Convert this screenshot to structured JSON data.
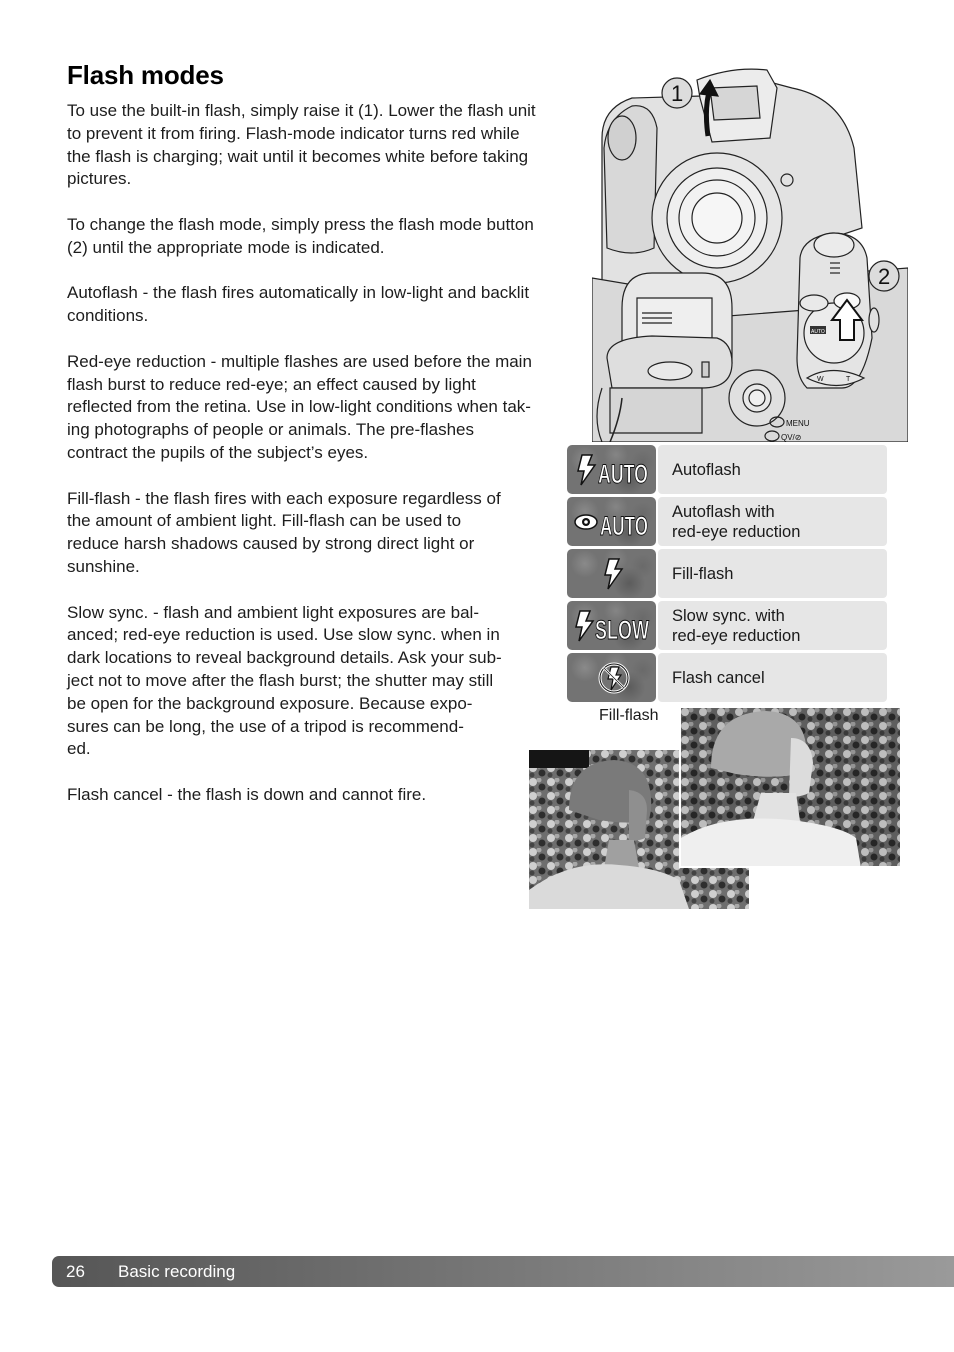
{
  "page": {
    "title": "Flash modes",
    "paragraphs": [
      "To use the built-in flash, simply raise it (1). Lower the flash unit\nto prevent it from firing. Flash-mode indicator turns red while\nthe flash is charging; wait until it becomes white before taking\npictures.",
      "To change the flash mode, simply press the flash mode button\n(2) until the appropriate mode is indicated.",
      "Autoflash - the flash fires automatically in low-light and backlit\nconditions.",
      "Red-eye reduction - multiple flashes are used before the main\nflash burst to reduce red-eye; an effect caused by light\nreflected from the retina. Use in low-light conditions when tak-\ning photographs of people or animals. The pre-flashes\ncontract the pupils of the subject’s eyes.",
      "Fill-flash - the flash fires with each exposure regardless of\nthe amount of ambient light. Fill-flash can be used to\nreduce harsh shadows caused by strong direct light or\nsunshine.",
      "Slow sync. - flash and ambient light exposures are bal-\nanced; red-eye reduction is used. Use slow sync. when in\ndark locations to reveal background details. Ask your sub-\nject not to move after the flash burst; the shutter may still\nbe open for the background exposure. Because expo-\nsures can be long, the use of a tripod is recommend-\ned.",
      "Flash cancel - the flash is down and cannot fire."
    ]
  },
  "illustration": {
    "callout_1": "1",
    "callout_2": "2",
    "dial_auto_label": "AUTO",
    "menu_label": "MENU",
    "qv_label": "QV/⊘",
    "zoom_w": "W",
    "zoom_t": "T"
  },
  "modes": [
    {
      "icon": "flash-auto-icon",
      "icon_text": "AUTO",
      "label": "Autoflash"
    },
    {
      "icon": "red-eye-auto-icon",
      "icon_text": "AUTO",
      "label": "Autoflash with\nred-eye reduction"
    },
    {
      "icon": "fill-flash-icon",
      "icon_text": "",
      "label": "Fill-flash"
    },
    {
      "icon": "flash-slow-icon",
      "icon_text": "SLOW",
      "label": "Slow sync. with\nred-eye reduction"
    },
    {
      "icon": "flash-cancel-icon",
      "icon_text": "",
      "label": "Flash cancel"
    }
  ],
  "photos": {
    "caption": "Fill-flash"
  },
  "footer": {
    "page_number": "26",
    "section": "Basic recording"
  }
}
